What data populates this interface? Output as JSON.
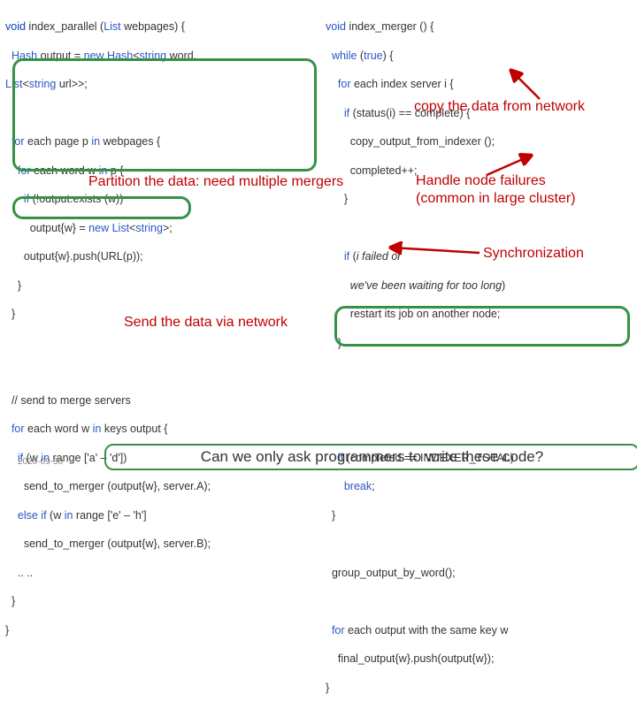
{
  "left": {
    "l1": "void index_parallel (List webpages) {",
    "l2": "  Hash output = new Hash<string word,",
    "l3": "List<string url>>;",
    "l4": "",
    "l5": "  for each page p in webpages {",
    "l6": "    for each word w in p {",
    "l7": "      if (!output.exists (w))",
    "l8": "        output{w} = new List<string>;",
    "l9": "      output{w}.push(URL(p));",
    "l10": "    }",
    "l11": "  }",
    "l12": "",
    "l13": "  // send to merge servers",
    "l14": "  for each word w in keys output {",
    "l15": "    if (w in range ['a' – 'd'])",
    "l16": "      send_to_merger (output{w}, server.A);",
    "l17": "    else if (w in range ['e' – 'h']",
    "l18": "      send_to_merger (output{w}, server.B);",
    "l19": "    .. ..",
    "l20": "  }",
    "l21": "}"
  },
  "right": {
    "r1": "void index_merger () {",
    "r2": "  while (true) {",
    "r3": "    for each index server i {",
    "r4": "      if (status(i) == complete) {",
    "r5": "        copy_output_from_indexer ();",
    "r6": "        completed++;",
    "r7": "      }",
    "r8": "",
    "r9": "      if (i failed or",
    "r10": "        we've been waiting for too long)",
    "r11": "        restart its job on another node;",
    "r12": "    }",
    "r13": "",
    "r14": "",
    "r15": "",
    "r16": "    if (completed == INDEXER_TOTAL)",
    "r17": "      break;",
    "r18": "  }",
    "r19": "",
    "r20": "  group_output_by_word();",
    "r21": "",
    "r22": "  for each output with the same key w",
    "r23": "    final_output{w}.push(output{w});",
    "r24": "}"
  },
  "annot": {
    "partition": "Partition the data: need multiple mergers",
    "send": "Send the data via network",
    "copy": "copy the data from network",
    "handle1": "Handle node failures",
    "handle2": "(common in large cluster)",
    "sync": "Synchronization"
  },
  "bottom": "Can we only ask programmers to write these code?",
  "date": "2020-09-30"
}
